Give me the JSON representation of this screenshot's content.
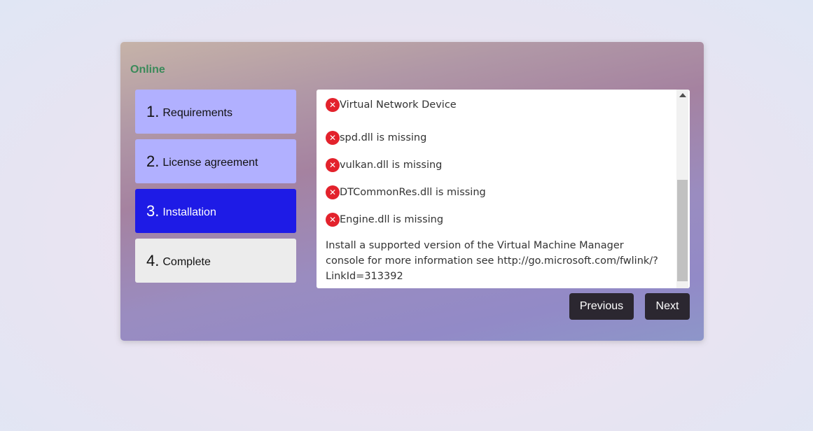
{
  "status": "Online",
  "steps": [
    {
      "number": "1.",
      "label": "Requirements"
    },
    {
      "number": "2.",
      "label": "License agreement"
    },
    {
      "number": "3.",
      "label": "Installation"
    },
    {
      "number": "4.",
      "label": "Complete"
    }
  ],
  "errors": [
    "Virtual Network Device",
    "spd.dll is missing",
    "vulkan.dll is missing",
    "DTCommonRes.dll is missing",
    "Engine.dll is missing"
  ],
  "error_icon": "error-x-icon",
  "info_message": "Install a supported version of the Virtual Machine Manager console for more information see http://go.microsoft.com/fwlink/?LinkId=313392",
  "buttons": {
    "previous": "Previous",
    "next": "Next"
  },
  "colors": {
    "status": "#3b8a5a",
    "active_step": "#1e1be6",
    "done_step": "#b1b0ff",
    "pending_step": "#ececec",
    "error_icon": "#e3222c",
    "button": "#2b2730"
  }
}
